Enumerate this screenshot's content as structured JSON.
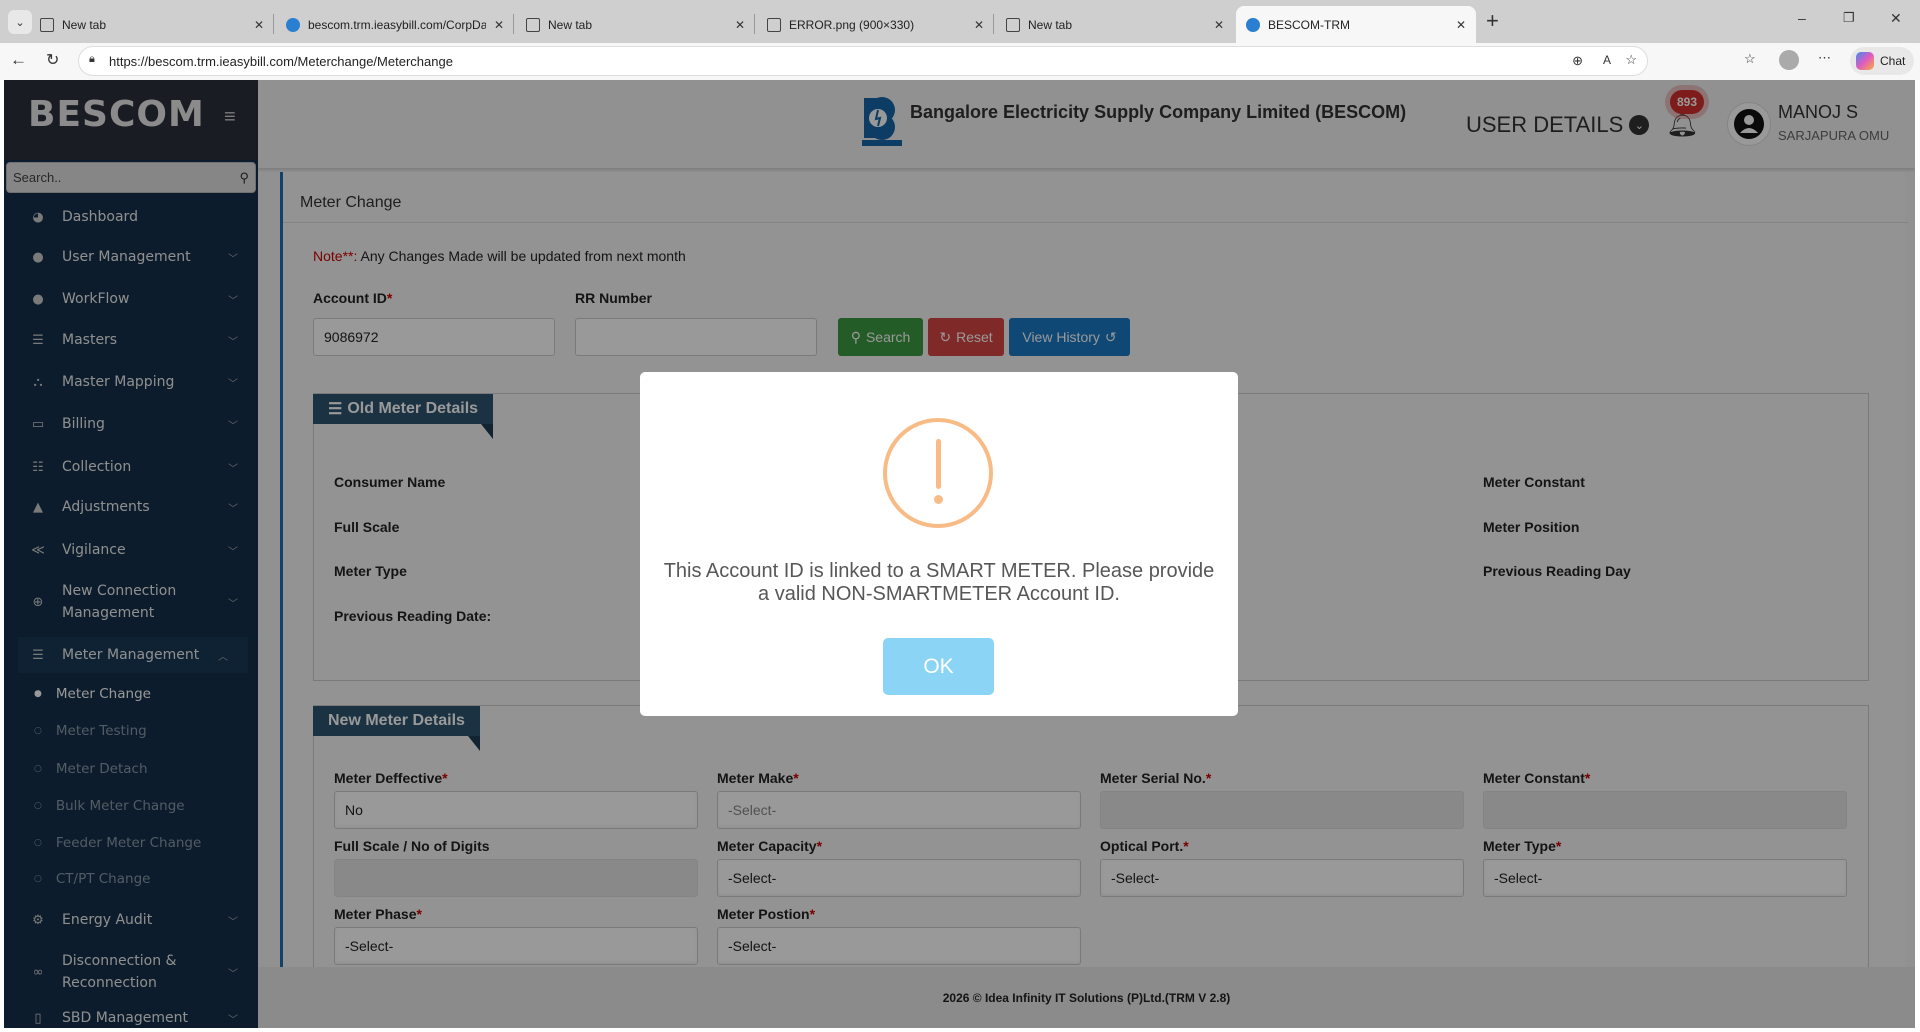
{
  "browser": {
    "tabs": [
      {
        "title": "New tab"
      },
      {
        "title": "bescom.trm.ieasybill.com/CorpDas"
      },
      {
        "title": "New tab"
      },
      {
        "title": "ERROR.png (900×330)"
      },
      {
        "title": "New tab"
      },
      {
        "title": "BESCOM-TRM"
      }
    ],
    "url": "https://bescom.trm.ieasybill.com/Meterchange/Meterchange",
    "chat_label": "Chat"
  },
  "sidebar": {
    "brand": "BESCOM",
    "search_placeholder": "Search..",
    "items": [
      {
        "label": "Dashboard",
        "icon": "dashboard-icon",
        "g": "◕",
        "chev": false
      },
      {
        "label": "User Management",
        "icon": "user-icon",
        "g": "●",
        "chev": true
      },
      {
        "label": "WorkFlow",
        "icon": "user-icon",
        "g": "●",
        "chev": true
      },
      {
        "label": "Masters",
        "icon": "list-icon",
        "g": "☰",
        "chev": true
      },
      {
        "label": "Master Mapping",
        "icon": "sitemap-icon",
        "g": "⛬",
        "chev": true
      },
      {
        "label": "Billing",
        "icon": "monitor-icon",
        "g": "▭",
        "chev": true
      },
      {
        "label": "Collection",
        "icon": "list-ol-icon",
        "g": "☷",
        "chev": true
      },
      {
        "label": "Adjustments",
        "icon": "road-icon",
        "g": "▲",
        "chev": true
      },
      {
        "label": "Vigilance",
        "icon": "vk-icon",
        "g": "≪",
        "chev": true
      },
      {
        "label": "New Connection Manage­ment",
        "icon": "plus-circle-icon",
        "g": "⊕",
        "chev": true
      },
      {
        "label": "Meter Management",
        "icon": "list-icon",
        "g": "☰",
        "chev": true,
        "open": true
      },
      {
        "label": "Energy Audit",
        "icon": "cogs-icon",
        "g": "⚙",
        "chev": true
      },
      {
        "label": "Disconnection & Reconne­ction",
        "icon": "link-icon",
        "g": "∞",
        "chev": true
      },
      {
        "label": "SBD Management",
        "icon": "mobile-icon",
        "g": "▯",
        "chev": true
      }
    ],
    "submenu": [
      "Meter Change",
      "Meter Testing",
      "Meter Detach",
      "Bulk Meter Change",
      "Feeder Meter Change",
      "CT/PT Change"
    ]
  },
  "header": {
    "org_title": "Bangalore Electricity Supply Company Limited (BESCOM)",
    "logo_text": "BESCOM",
    "user_details_label": "USER DETAILS",
    "notification_count": "893",
    "user_name": "MANOJ S",
    "user_location": "SARJAPURA OMU"
  },
  "main": {
    "title": "Meter Change",
    "note_prefix": "Note**:",
    "note_text": " Any Changes Made will be updated from next month",
    "account_id_label": "Account ID",
    "account_id_value": "9086972",
    "rr_number_label": "RR Number",
    "rr_number_value": "",
    "search_label": "Search",
    "reset_label": "Reset",
    "view_history_label": "View History",
    "old_meter": {
      "title": "Old Meter Details",
      "left_labels": [
        "Consumer Name",
        "Full Scale",
        "Meter Type",
        "Previous Reading Date:"
      ],
      "right_labels": [
        "Meter Constant",
        "Meter Position",
        "Previous Reading Day"
      ]
    },
    "new_meter": {
      "title": "New Meter Details",
      "fields": [
        {
          "label": "Meter Deffective",
          "req": true,
          "value": "No",
          "kind": "sel"
        },
        {
          "label": "Meter Make",
          "req": true,
          "value": "-Select-",
          "kind": "selg"
        },
        {
          "label": "Meter Serial No.",
          "req": true,
          "value": "",
          "kind": "dis"
        },
        {
          "label": "Meter Constant",
          "req": true,
          "value": "",
          "kind": "dis"
        },
        {
          "label": "Full Scale / No of Digits",
          "req": false,
          "value": "",
          "kind": "dis"
        },
        {
          "label": "Meter Capacity",
          "req": true,
          "value": "-Select-",
          "kind": "sel"
        },
        {
          "label": "Optical Port.",
          "req": true,
          "value": "-Select-",
          "kind": "sel"
        },
        {
          "label": "Meter Type",
          "req": true,
          "value": "-Select-",
          "kind": "sel"
        },
        {
          "label": "Meter Phase",
          "req": true,
          "value": "-Select-",
          "kind": "sel"
        },
        {
          "label": "Meter Postion",
          "req": true,
          "value": "-Select-",
          "kind": "sel"
        }
      ]
    }
  },
  "footer": {
    "text": "2026 © Idea Infinity IT Solutions (P)Ltd.(TRM V 2.8)"
  },
  "modal": {
    "icon": "warning-icon",
    "message": "This Account ID is linked to a SMART METER. Please provide a valid NON-SMARTMETER Account ID.",
    "ok_label": "OK"
  }
}
